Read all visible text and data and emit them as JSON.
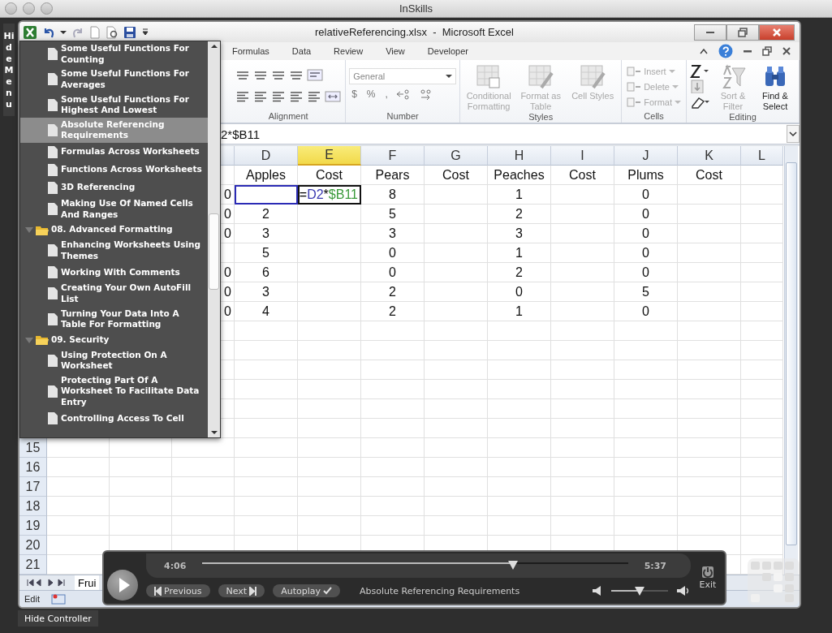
{
  "app": {
    "title": "InSkills",
    "hide_menu": "HideMenu",
    "hide_controller": "Hide Controller"
  },
  "excel": {
    "title": "relativeReferencing.xlsx  -  Microsoft Excel",
    "tabs": [
      {
        "label": "Formulas"
      },
      {
        "label": "Data"
      },
      {
        "label": "Review"
      },
      {
        "label": "View"
      },
      {
        "label": "Developer"
      }
    ],
    "ribbon": {
      "groups": [
        {
          "kind": "alignment",
          "label": "Alignment"
        },
        {
          "kind": "number",
          "label": "Number",
          "format": "General",
          "symbols": [
            "$",
            "%",
            ","
          ]
        },
        {
          "kind": "styles",
          "label": "Styles",
          "buttons": [
            {
              "label": "Conditional Formatting",
              "disabled": true
            },
            {
              "label": "Format as Table",
              "disabled": true
            },
            {
              "label": "Cell Styles",
              "disabled": true
            }
          ]
        },
        {
          "kind": "cells",
          "label": "Cells",
          "buttons": [
            {
              "label": "Insert",
              "disabled": true
            },
            {
              "label": "Delete",
              "disabled": true
            },
            {
              "label": "Format",
              "disabled": true
            }
          ]
        },
        {
          "kind": "editing",
          "label": "Editing",
          "buttons": [
            {
              "label": "Sort & Filter",
              "disabled": true
            },
            {
              "label": "Find & Select",
              "disabled": false
            }
          ]
        }
      ]
    },
    "formula": "2*$B11",
    "columns": [
      {
        "label": "D",
        "selected": false
      },
      {
        "label": "E",
        "selected": true
      },
      {
        "label": "F",
        "selected": false
      },
      {
        "label": "G",
        "selected": false
      },
      {
        "label": "H",
        "selected": false
      },
      {
        "label": "I",
        "selected": false
      },
      {
        "label": "J",
        "selected": false
      },
      {
        "label": "K",
        "selected": false
      },
      {
        "label": "L",
        "selected": false
      }
    ],
    "rows": [
      {
        "cells": [
          "Apples",
          "Cost",
          "Pears",
          "Cost",
          "Peaches",
          "Cost",
          "Plums",
          "Cost"
        ]
      },
      {
        "partial_cell": "0",
        "cells": [
          {
            "kind": "reference",
            "color": "#2b2bb5"
          },
          {
            "kind": "formula",
            "selected": true,
            "parts": [
              {
                "text": "=",
                "kind": "operator"
              },
              {
                "text": "D2",
                "kind": "reference",
                "color": "#3a3ab0"
              },
              {
                "text": "*",
                "kind": "operator"
              },
              {
                "text": "$B11",
                "kind": "reference",
                "color": "#3a9a3a"
              }
            ]
          },
          "8",
          null,
          "1",
          null,
          "0",
          null
        ]
      },
      {
        "partial_cell": "0",
        "cells": [
          "2",
          null,
          "5",
          null,
          "2",
          null,
          "0",
          null
        ]
      },
      {
        "partial_cell": "0",
        "cells": [
          "3",
          null,
          "3",
          null,
          "3",
          null,
          "0",
          null
        ]
      },
      {
        "cells": [
          "5",
          null,
          "0",
          null,
          "1",
          null,
          "0",
          null
        ]
      },
      {
        "partial_cell": "0",
        "cells": [
          "6",
          null,
          "0",
          null,
          "2",
          null,
          "0",
          null
        ]
      },
      {
        "partial_cell": "0",
        "cells": [
          "3",
          null,
          "2",
          null,
          "0",
          null,
          "5",
          null
        ]
      },
      {
        "partial_cell": "0",
        "cells": [
          "4",
          null,
          "2",
          null,
          "1",
          null,
          "0",
          null
        ]
      }
    ],
    "row_numbers": [
      "15",
      "16",
      "17",
      "18",
      "19",
      "20",
      "21"
    ],
    "sheet_tabs": [
      {
        "label": "Frui",
        "selected": true
      }
    ],
    "status": "Edit"
  },
  "menu": {
    "items": [
      {
        "kind": "lesson",
        "label": "Some Useful Functions For Counting",
        "selected": false
      },
      {
        "kind": "lesson",
        "label": "Some Useful Functions For Averages",
        "selected": false
      },
      {
        "kind": "lesson",
        "label": "Some Useful Functions For Highest And Lowest",
        "selected": false
      },
      {
        "kind": "lesson",
        "label": "Absolute Referencing Requirements",
        "selected": true
      },
      {
        "kind": "lesson",
        "label": "Formulas Across Worksheets",
        "selected": false
      },
      {
        "kind": "lesson",
        "label": "Functions Across Worksheets",
        "selected": false
      },
      {
        "kind": "lesson",
        "label": "3D Referencing",
        "selected": false
      },
      {
        "kind": "lesson",
        "label": "Making Use Of Named Cells And Ranges",
        "selected": false
      },
      {
        "kind": "section",
        "label": "08. Advanced Formatting",
        "expanded": true,
        "children": [
          {
            "kind": "lesson",
            "label": "Enhancing Worksheets Using Themes",
            "selected": false
          },
          {
            "kind": "lesson",
            "label": "Working With Comments",
            "selected": false
          },
          {
            "kind": "lesson",
            "label": "Creating Your Own AutoFill List",
            "selected": false
          },
          {
            "kind": "lesson",
            "label": "Turning Your Data Into A Table For Formatting",
            "selected": false
          }
        ]
      },
      {
        "kind": "section",
        "label": "09. Security",
        "expanded": true,
        "children": [
          {
            "kind": "lesson",
            "label": "Using Protection On A Worksheet",
            "selected": false
          },
          {
            "kind": "lesson",
            "label": "Protecting Part Of A Worksheet To Facilitate Data Entry",
            "selected": false
          },
          {
            "kind": "lesson",
            "label": "Controlling Access To Cell",
            "selected": false
          }
        ]
      }
    ]
  },
  "controller": {
    "current": "4:06",
    "total": "5:37",
    "progress": {
      "level": 0.73
    },
    "buttons": [
      {
        "kind": "previous",
        "label": "Previous"
      },
      {
        "kind": "next",
        "label": "Next"
      },
      {
        "kind": "autoplay",
        "label": "Autoplay",
        "checked": true
      }
    ],
    "lesson": "Absolute Referencing Requirements",
    "volume": {
      "level": 0.5
    },
    "exit": "Exit"
  }
}
